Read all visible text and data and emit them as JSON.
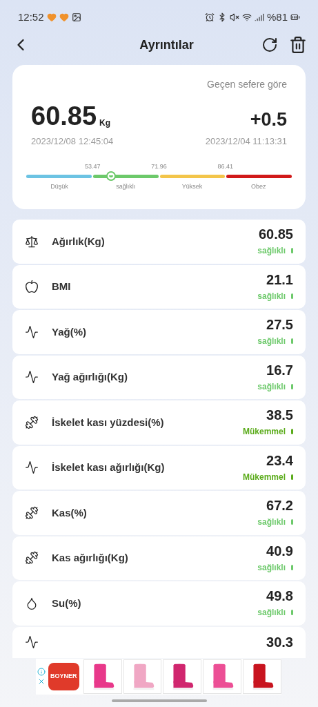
{
  "status_bar": {
    "time": "12:52",
    "battery": "%81"
  },
  "header": {
    "title": "Ayrıntılar"
  },
  "summary": {
    "compare_label": "Geçen sefere göre",
    "weight": "60.85",
    "unit": "Kg",
    "date": "2023/12/08 12:45:04",
    "change": "+0.5",
    "previous_date": "2023/12/04 11:13:31",
    "gauge": {
      "thresholds": [
        "53.47",
        "71.96",
        "86.41"
      ],
      "segments": [
        {
          "label": "Düşük",
          "color": "#6cc3e3",
          "selected": false
        },
        {
          "label": "sağlıklı",
          "color": "#6cc96a",
          "selected": true
        },
        {
          "label": "Yüksek",
          "color": "#f3c54a",
          "selected": false
        },
        {
          "label": "Obez",
          "color": "#d11a1a",
          "selected": false
        }
      ]
    }
  },
  "metrics": [
    {
      "label": "Ağırlık(Kg)",
      "value": "60.85",
      "status": "sağlıklı",
      "kind": "healthy"
    },
    {
      "label": "BMI",
      "value": "21.1",
      "status": "sağlıklı",
      "kind": "healthy"
    },
    {
      "label": "Yağ(%)",
      "value": "27.5",
      "status": "sağlıklı",
      "kind": "healthy"
    },
    {
      "label": "Yağ ağırlığı(Kg)",
      "value": "16.7",
      "status": "sağlıklı",
      "kind": "healthy"
    },
    {
      "label": "İskelet kası yüzdesi(%)",
      "value": "38.5",
      "status": "Mükemmel",
      "kind": "excellent"
    },
    {
      "label": "İskelet kası ağırlığı(Kg)",
      "value": "23.4",
      "status": "Mükemmel",
      "kind": "excellent"
    },
    {
      "label": "Kas(%)",
      "value": "67.2",
      "status": "sağlıklı",
      "kind": "healthy"
    },
    {
      "label": "Kas ağırlığı(Kg)",
      "value": "40.9",
      "status": "sağlıklı",
      "kind": "healthy"
    },
    {
      "label": "Su(%)",
      "value": "49.8",
      "status": "sağlıklı",
      "kind": "healthy"
    },
    {
      "value": "30.3"
    }
  ],
  "ad": {
    "brand": "BOYNER"
  }
}
